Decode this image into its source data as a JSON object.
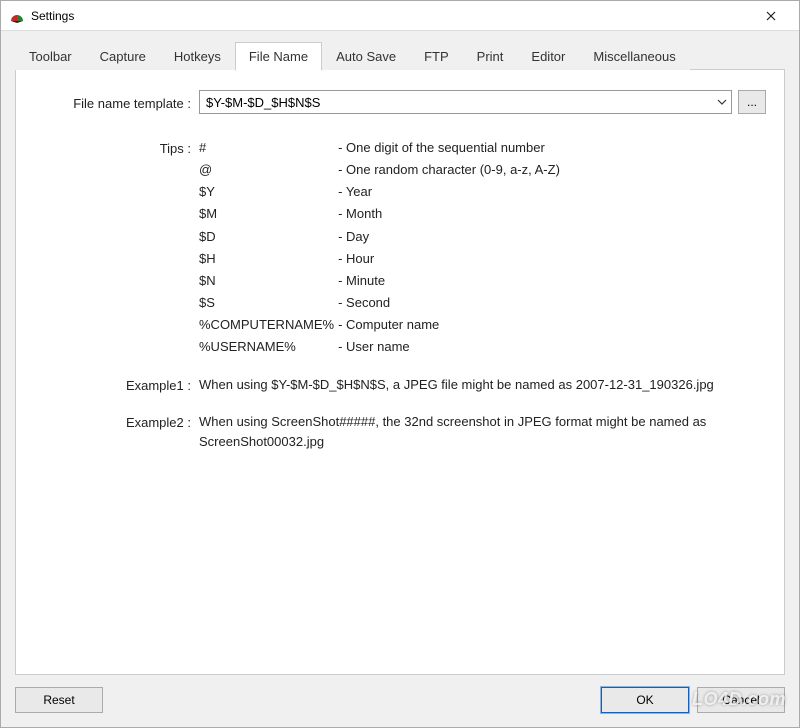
{
  "window": {
    "title": "Settings"
  },
  "tabs": [
    {
      "label": "Toolbar",
      "active": false
    },
    {
      "label": "Capture",
      "active": false
    },
    {
      "label": "Hotkeys",
      "active": false
    },
    {
      "label": "File Name",
      "active": true
    },
    {
      "label": "Auto Save",
      "active": false
    },
    {
      "label": "FTP",
      "active": false
    },
    {
      "label": "Print",
      "active": false
    },
    {
      "label": "Editor",
      "active": false
    },
    {
      "label": "Miscellaneous",
      "active": false
    }
  ],
  "fileName": {
    "templateLabel": "File name template :",
    "templateValue": "$Y-$M-$D_$H$N$S",
    "browseLabel": "...",
    "tipsLabel": "Tips :",
    "tips": [
      {
        "symbol": "#",
        "sep": "  -",
        "desc": "One digit of the sequential number"
      },
      {
        "symbol": "@",
        "sep": "  -",
        "desc": "One random character (0-9, a-z, A-Z)"
      },
      {
        "symbol": "$Y",
        "sep": " -",
        "desc": " Year"
      },
      {
        "symbol": "$M",
        "sep": " -",
        "desc": " Month"
      },
      {
        "symbol": "$D",
        "sep": " -",
        "desc": " Day"
      },
      {
        "symbol": "$H",
        "sep": " -",
        "desc": " Hour"
      },
      {
        "symbol": "$N",
        "sep": " -",
        "desc": " Minute"
      },
      {
        "symbol": "$S",
        "sep": " -",
        "desc": " Second"
      },
      {
        "symbol": "%COMPUTERNAME%",
        "sep": " -",
        "desc": "Computer name"
      },
      {
        "symbol": "%USERNAME%",
        "sep": " -",
        "desc": "User name"
      }
    ],
    "example1Label": "Example1 :",
    "example1Text": "When using $Y-$M-$D_$H$N$S, a JPEG file might be named as 2007-12-31_190326.jpg",
    "example2Label": "Example2 :",
    "example2Text": "When using ScreenShot#####, the 32nd screenshot in JPEG format might be named as ScreenShot00032.jpg"
  },
  "buttons": {
    "reset": "Reset",
    "ok": "OK",
    "cancel": "Cancel"
  },
  "watermark": "LO4D.com"
}
